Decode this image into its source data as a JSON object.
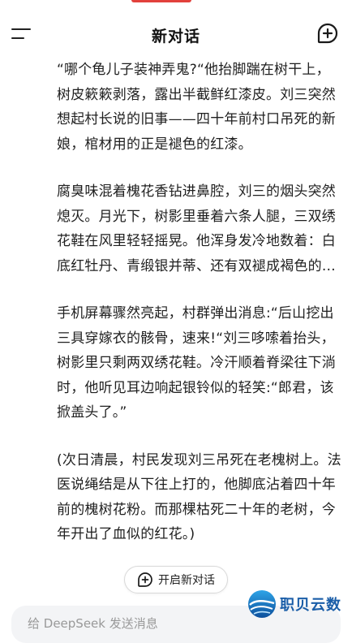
{
  "header": {
    "title": "新对话"
  },
  "conversation": {
    "paragraphs": [
      "“哪个龟儿子装神弄鬼?“他抬脚踹在树干上，树皮簌簌剥落，露出半截鲜红漆皮。刘三突然想起村长说的旧事——四十年前村口吊死的新娘，棺材用的正是褪色的红漆。",
      "腐臭味混着槐花香钻进鼻腔，刘三的烟头突然熄灭。月光下，树影里垂着六条人腿，三双绣花鞋在风里轻轻摇晃。他浑身发冷地数着：白底红牡丹、青缎银并蒂、还有双褪成褐色的…",
      "手机屏幕骤然亮起，村群弹出消息:“后山挖出三具穿嫁衣的骸骨，速来!“刘三哆嗦着抬头，树影里只剩两双绣花鞋。冷汗顺着脊梁往下淌时，他听见耳边响起银铃似的轻笑:“郎君，该掀盖头了。”",
      "(次日清晨，村民发现刘三吊死在老槐树上。法医说绳结是从下往上打的，他脚底沾着四十年前的槐树花粉。而那棵枯死二十年的老树，今年开出了血似的红花。)"
    ]
  },
  "new_chat_pill": {
    "label": "开启新对话"
  },
  "input": {
    "placeholder": "给 DeepSeek 发送消息"
  },
  "watermark": {
    "text": "职贝云数"
  },
  "icons": {
    "menu": "menu-icon",
    "new_chat": "new-chat-plus-icon",
    "pill": "chat-plus-icon",
    "watermark_logo": "globe-logo-icon"
  },
  "colors": {
    "accent": "#e2413c",
    "text": "#1f1f1f",
    "watermark": "#1b5ea8",
    "input_bg": "#f3f4f6"
  }
}
